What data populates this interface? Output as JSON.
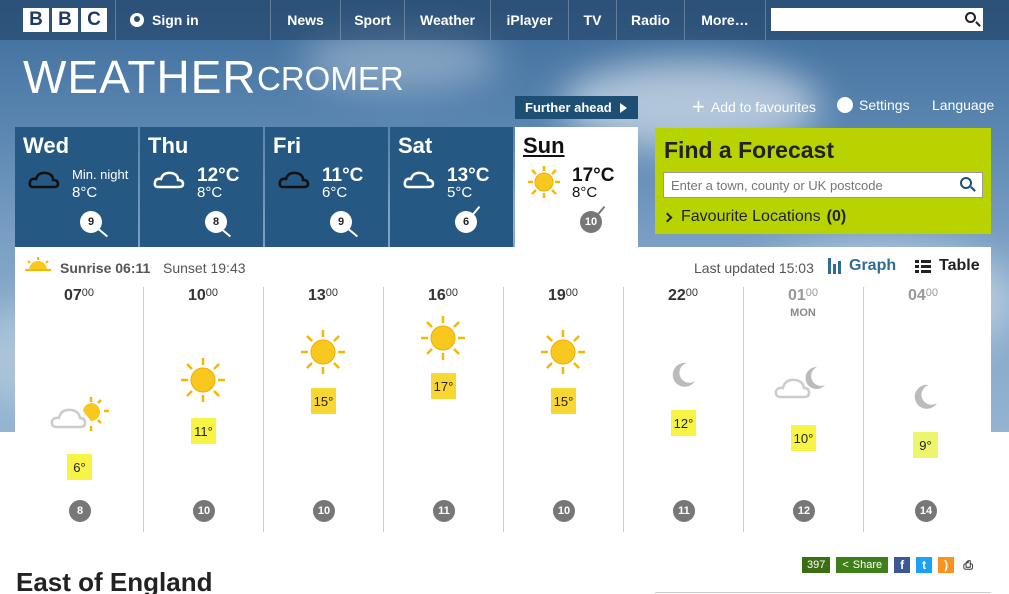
{
  "header": {
    "logo_letters": [
      "B",
      "B",
      "C"
    ],
    "sign_in": "Sign in",
    "nav": [
      "News",
      "Sport",
      "Weather",
      "iPlayer",
      "TV",
      "Radio",
      "More…"
    ],
    "search_placeholder": ""
  },
  "page": {
    "title": "WEATHER",
    "location": "CROMER",
    "further_ahead": "Further ahead",
    "add_favourites": "Add to favourites",
    "settings": "Settings",
    "language": "Language"
  },
  "days": [
    {
      "name": "Wed",
      "min_label": "Min. night",
      "high": "",
      "low": "8°C",
      "wind": "9",
      "icon": "cloud-night-icon"
    },
    {
      "name": "Thu",
      "min_label": "",
      "high": "12°C",
      "low": "8°C",
      "wind": "8",
      "icon": "cloud-icon"
    },
    {
      "name": "Fri",
      "min_label": "",
      "high": "11°C",
      "low": "6°C",
      "wind": "9",
      "icon": "cloud-night-icon"
    },
    {
      "name": "Sat",
      "min_label": "",
      "high": "13°C",
      "low": "5°C",
      "wind": "6",
      "icon": "cloud-icon"
    },
    {
      "name": "Sun",
      "min_label": "",
      "high": "17°C",
      "low": "8°C",
      "wind": "10",
      "icon": "sun-icon"
    }
  ],
  "find_forecast": {
    "title": "Find a Forecast",
    "placeholder": "Enter a town, county or UK postcode",
    "favourites_label": "Favourite Locations",
    "favourites_count": "(0)"
  },
  "hourly": {
    "sunrise": "Sunrise 06:11",
    "sunset": "Sunset 19:43",
    "last_updated": "Last updated 15:03",
    "graph": "Graph",
    "table": "Table",
    "hours": [
      {
        "h": "07",
        "m": "00",
        "day": "",
        "temp": "6°",
        "wind": "8",
        "icon": "sun-cloud-icon"
      },
      {
        "h": "10",
        "m": "00",
        "day": "",
        "temp": "11°",
        "wind": "10",
        "icon": "sun-icon"
      },
      {
        "h": "13",
        "m": "00",
        "day": "",
        "temp": "15°",
        "wind": "10",
        "icon": "sun-icon"
      },
      {
        "h": "16",
        "m": "00",
        "day": "",
        "temp": "17°",
        "wind": "11",
        "icon": "sun-icon"
      },
      {
        "h": "19",
        "m": "00",
        "day": "",
        "temp": "15°",
        "wind": "10",
        "icon": "sun-icon"
      },
      {
        "h": "22",
        "m": "00",
        "day": "",
        "temp": "12°",
        "wind": "11",
        "icon": "moon-icon"
      },
      {
        "h": "01",
        "m": "00",
        "day": "MON",
        "temp": "10°",
        "wind": "12",
        "icon": "cloud-moon-icon"
      },
      {
        "h": "04",
        "m": "00",
        "day": "",
        "temp": "9°",
        "wind": "14",
        "icon": "moon-icon"
      }
    ]
  },
  "footer": {
    "region_title": "East of England",
    "share_count": "397",
    "share_label": "Share"
  }
}
